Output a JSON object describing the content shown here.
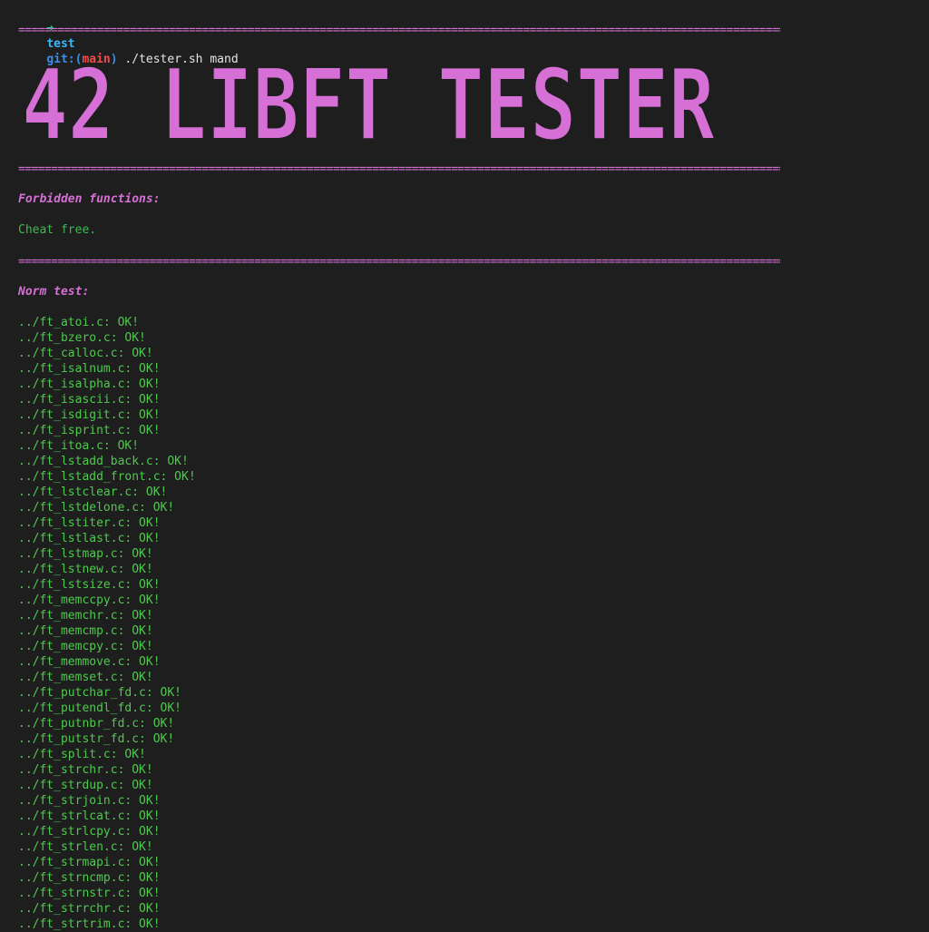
{
  "prompt": {
    "arrow": "➜",
    "dir": "test",
    "git_label": "git:(",
    "branch": "main",
    "git_close": ")",
    "command": " ./tester.sh mand"
  },
  "separator": "===================================================================================================================================",
  "banner": {
    "text": "42 LIBFT TESTER",
    "color": "#d670d6"
  },
  "forbidden": {
    "heading": "Forbidden functions:",
    "result": "Cheat free."
  },
  "norm": {
    "heading": "Norm test:",
    "files": [
      "../ft_atoi.c: OK!",
      "../ft_bzero.c: OK!",
      "../ft_calloc.c: OK!",
      "../ft_isalnum.c: OK!",
      "../ft_isalpha.c: OK!",
      "../ft_isascii.c: OK!",
      "../ft_isdigit.c: OK!",
      "../ft_isprint.c: OK!",
      "../ft_itoa.c: OK!",
      "../ft_lstadd_back.c: OK!",
      "../ft_lstadd_front.c: OK!",
      "../ft_lstclear.c: OK!",
      "../ft_lstdelone.c: OK!",
      "../ft_lstiter.c: OK!",
      "../ft_lstlast.c: OK!",
      "../ft_lstmap.c: OK!",
      "../ft_lstnew.c: OK!",
      "../ft_lstsize.c: OK!",
      "../ft_memccpy.c: OK!",
      "../ft_memchr.c: OK!",
      "../ft_memcmp.c: OK!",
      "../ft_memcpy.c: OK!",
      "../ft_memmove.c: OK!",
      "../ft_memset.c: OK!",
      "../ft_putchar_fd.c: OK!",
      "../ft_putendl_fd.c: OK!",
      "../ft_putnbr_fd.c: OK!",
      "../ft_putstr_fd.c: OK!",
      "../ft_split.c: OK!",
      "../ft_strchr.c: OK!",
      "../ft_strdup.c: OK!",
      "../ft_strjoin.c: OK!",
      "../ft_strlcat.c: OK!",
      "../ft_strlcpy.c: OK!",
      "../ft_strlen.c: OK!",
      "../ft_strmapi.c: OK!",
      "../ft_strncmp.c: OK!",
      "../ft_strnstr.c: OK!",
      "../ft_strrchr.c: OK!",
      "../ft_strtrim.c: OK!"
    ]
  },
  "colors": {
    "background": "#1e1e1e",
    "magenta": "#d670d6",
    "green": "#3fb950"
  }
}
